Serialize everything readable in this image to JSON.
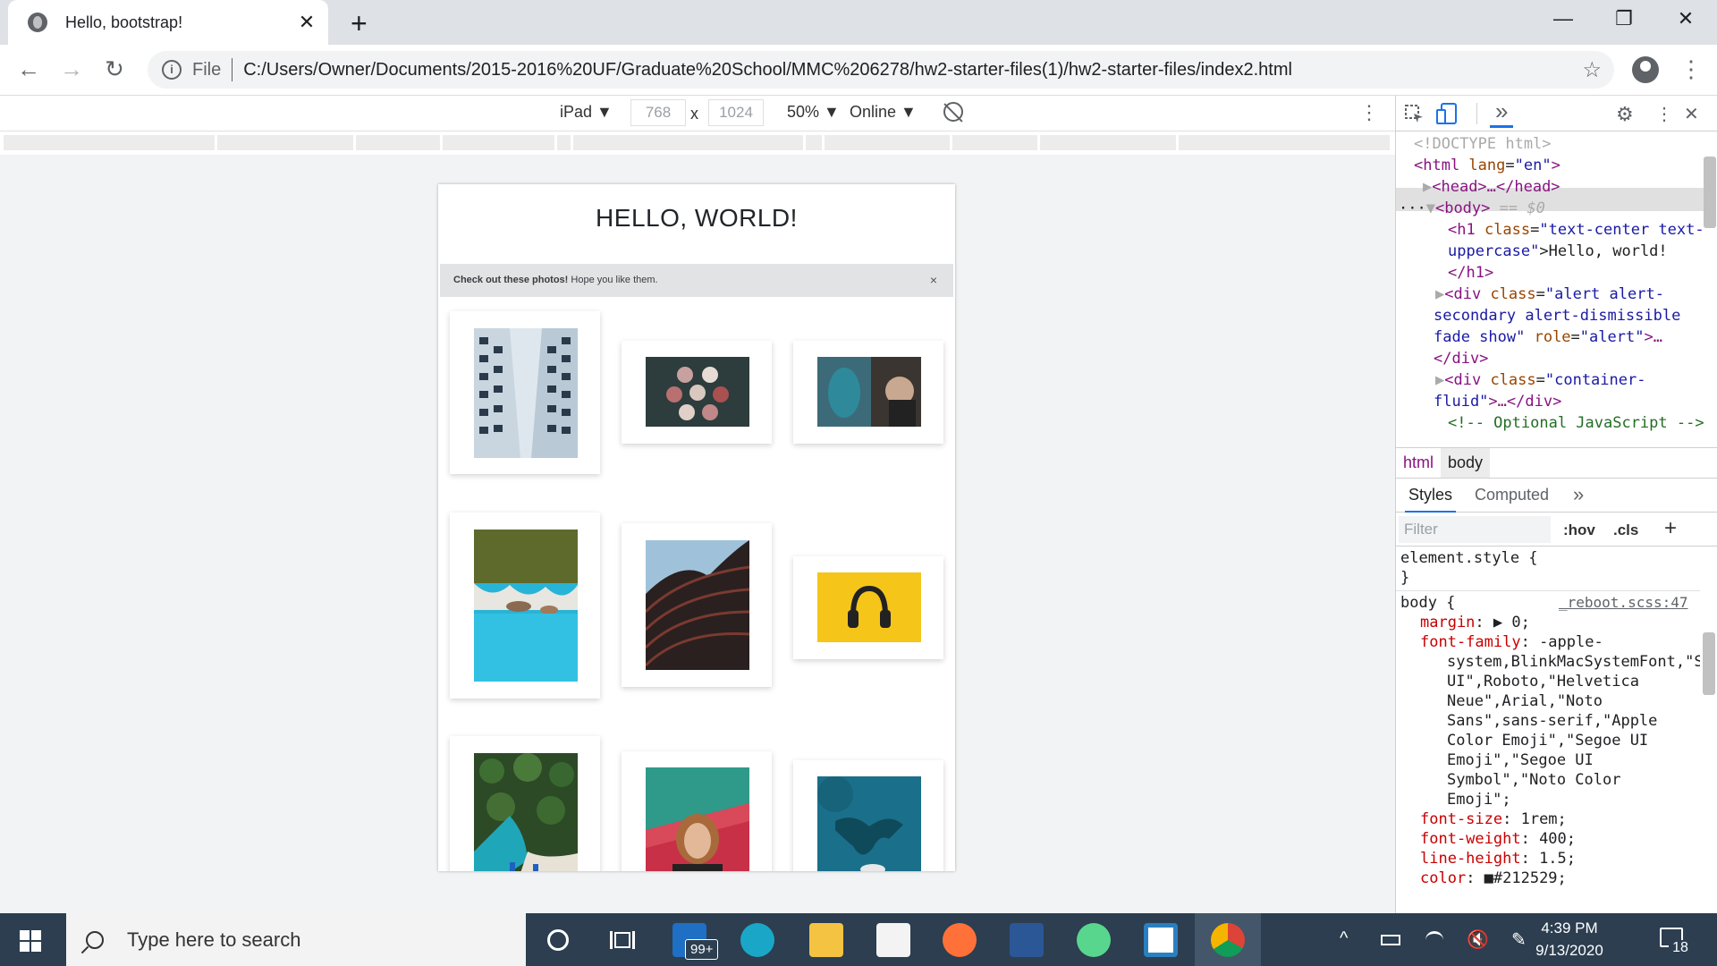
{
  "browser": {
    "tab_title": "Hello, bootstrap!",
    "tab_close": "✕",
    "new_tab": "+",
    "win_minimize": "—",
    "win_restore": "❐",
    "win_close": "✕",
    "back": "←",
    "forward": "→",
    "reload": "↻",
    "file_label": "File",
    "info_icon": "i",
    "url": "C:/Users/Owner/Documents/2015-2016%20UF/Graduate%20School/MMC%206278/hw2-starter-files(1)/hw2-starter-files/index2.html",
    "bookmark_star": "☆",
    "menu_kebab": "⋮"
  },
  "device_toolbar": {
    "device": "iPad ▼",
    "width": "768",
    "times": "x",
    "height": "1024",
    "zoom": "50% ▼",
    "throttle": "Online ▼",
    "more": "⋮"
  },
  "page": {
    "heading": "Hello, world!",
    "alert_bold": "Check out these photos!",
    "alert_text": " Hope you like them.",
    "alert_close": "×"
  },
  "devtools": {
    "more_tabs": "»",
    "settings": "⚙",
    "kebab": "⋮",
    "close": "✕",
    "dom": {
      "doctype": "<!DOCTYPE html>",
      "html_open": "<html ",
      "html_lang_attr": "lang",
      "html_lang_val": "\"en\"",
      "html_close_br": ">",
      "head": "<head>…</head>",
      "body_tag": "<body>",
      "body_marker": " == $0",
      "h1_open": "<h1 ",
      "h1_class_attr": "class",
      "h1_class_val_1": "\"text-center text-",
      "h1_class_val_2": "uppercase\"",
      "h1_text": ">Hello, world!",
      "h1_close": "</h1>",
      "div1_open": "<div ",
      "div1_class_attr": "class",
      "div1_class_val_1": "\"alert alert-",
      "div1_class_val_2": "secondary alert-dismissible",
      "div1_class_val_3": "fade show\"",
      "div1_role_attr": " role",
      "div1_role_val": "\"alert\"",
      "div1_rest": ">…",
      "div_close": "</div>",
      "div2_open": "<div ",
      "div2_class_attr": "class",
      "div2_class_val_1": "\"container-",
      "div2_class_val_2": "fluid\"",
      "div2_rest": ">…</div>",
      "comment": "<!-- Optional JavaScript -->",
      "dots": "···",
      "eq": "="
    },
    "breadcrumbs": [
      "html",
      "body"
    ],
    "styles_tabs": {
      "styles": "Styles",
      "computed": "Computed",
      "more": "»"
    },
    "filter_placeholder": "Filter",
    "hov": ":hov",
    "cls": ".cls",
    "plus": "+",
    "element_style": "element.style {",
    "close_brace": "}",
    "body_selector": "body {",
    "source_link": "_reboot.scss:47",
    "props": [
      {
        "name": "margin",
        "value": ": ▶ 0;"
      },
      {
        "name": "font-family",
        "value": ": -apple-"
      },
      {
        "name": "",
        "value": "system,BlinkMacSystemFont,\"S"
      },
      {
        "name": "",
        "value": "UI\",Roboto,\"Helvetica"
      },
      {
        "name": "",
        "value": "Neue\",Arial,\"Noto"
      },
      {
        "name": "",
        "value": "Sans\",sans-serif,\"Apple"
      },
      {
        "name": "",
        "value": "Color Emoji\",\"Segoe UI"
      },
      {
        "name": "",
        "value": "Emoji\",\"Segoe UI"
      },
      {
        "name": "",
        "value": "Symbol\",\"Noto Color"
      },
      {
        "name": "",
        "value": "Emoji\";"
      },
      {
        "name": "font-size",
        "value": ": 1rem;"
      },
      {
        "name": "font-weight",
        "value": ": 400;"
      },
      {
        "name": "line-height",
        "value": ": 1.5;"
      },
      {
        "name": "color",
        "value": ": ■#212529;"
      }
    ]
  },
  "taskbar": {
    "search_placeholder": "Type here to search",
    "mail_badge": "99+",
    "time": "4:39 PM",
    "date": "9/13/2020",
    "notif_count": "18"
  },
  "colors": {
    "taskbar": "#2c3e50",
    "alert_bg": "#e2e3e5",
    "devtools_tag": "#881280"
  }
}
